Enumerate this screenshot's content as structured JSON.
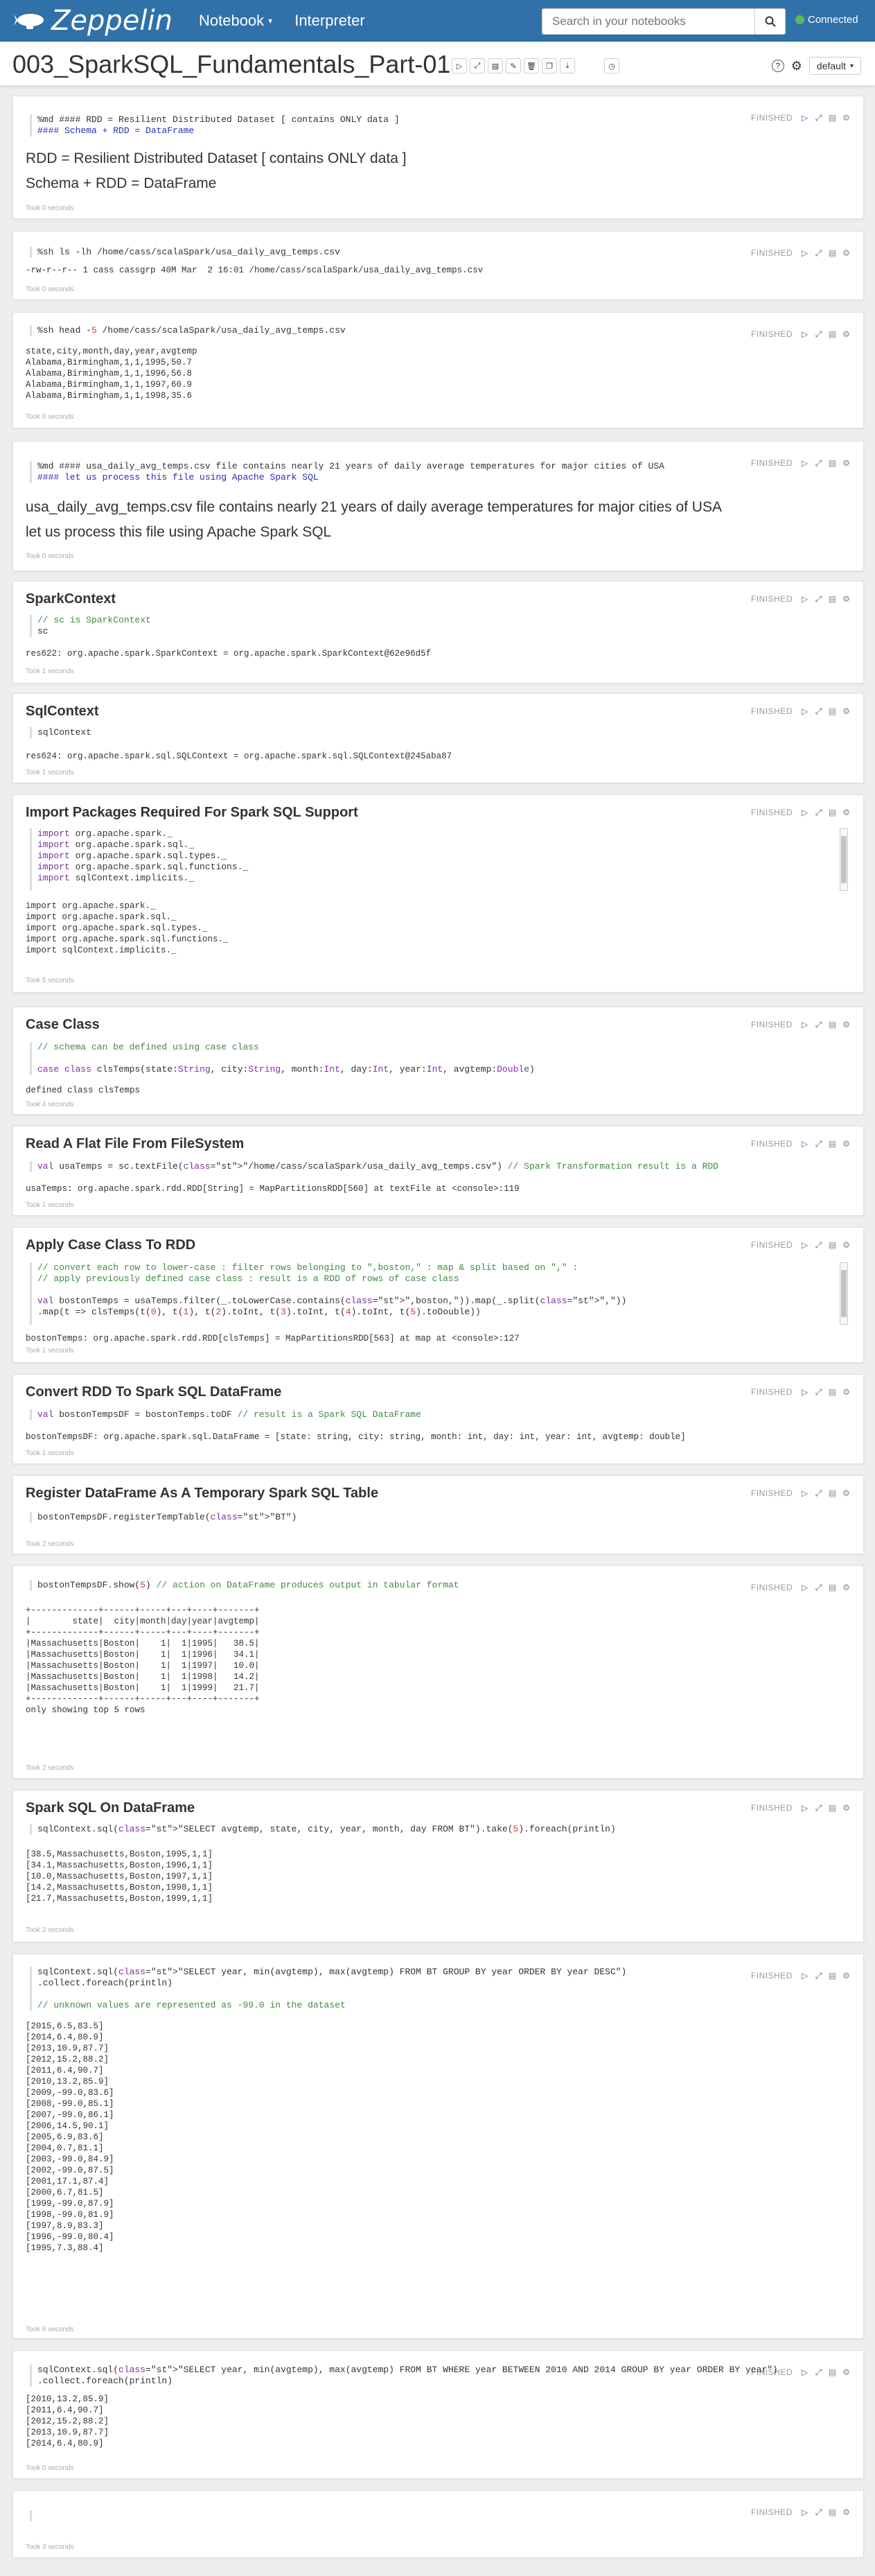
{
  "nav": {
    "brand": "Zeppelin",
    "notebook_menu": "Notebook",
    "interpreter": "Interpreter",
    "search_placeholder": "Search in your notebooks",
    "connection_status": "Connected"
  },
  "notebook": {
    "title": "003_SparkSQL_Fundamentals_Part-01",
    "default_button": "default"
  },
  "paragraphs": [
    {
      "status": "FINISHED",
      "took": "Took 0 seconds",
      "code": [
        "%md #### RDD = Resilient Distributed Dataset [ contains ONLY data ]",
        "#### Schema + RDD = DataFrame"
      ],
      "rendered": [
        "RDD = Resilient Distributed Dataset [ contains ONLY data ]",
        "Schema + RDD = DataFrame"
      ]
    },
    {
      "status": "FINISHED",
      "took": "Took 0 seconds",
      "code": [
        "%sh ls -lh /home/cass/scalaSpark/usa_daily_avg_temps.csv"
      ],
      "output": [
        "-rw-r--r-- 1 cass cassgrp 40M Mar  2 16:01 /home/cass/scalaSpark/usa_daily_avg_temps.csv"
      ]
    },
    {
      "status": "FINISHED",
      "took": "Took 0 seconds",
      "code": [
        "%sh head -5 /home/cass/scalaSpark/usa_daily_avg_temps.csv"
      ],
      "output": [
        "state,city,month,day,year,avgtemp",
        "Alabama,Birmingham,1,1,1995,50.7",
        "Alabama,Birmingham,1,1,1996,56.8",
        "Alabama,Birmingham,1,1,1997,60.9",
        "Alabama,Birmingham,1,1,1998,35.6"
      ]
    },
    {
      "status": "FINISHED",
      "took": "Took 0 seconds",
      "code": [
        "%md #### usa_daily_avg_temps.csv file contains nearly 21 years of daily average temperatures for major cities of USA",
        "#### let us process this file using Apache Spark SQL"
      ],
      "rendered": [
        "usa_daily_avg_temps.csv file contains nearly 21 years of daily average temperatures for major cities of USA",
        "let us process this file using Apache Spark SQL"
      ]
    },
    {
      "title": "SparkContext",
      "status": "FINISHED",
      "took": "Took 1 seconds",
      "code": [
        "// sc is SparkContext",
        "sc"
      ],
      "output": [
        "res622: org.apache.spark.SparkContext = org.apache.spark.SparkContext@62e96d5f"
      ]
    },
    {
      "title": "SqlContext",
      "status": "FINISHED",
      "took": "Took 1 seconds",
      "code": [
        "sqlContext"
      ],
      "output": [
        "res624: org.apache.spark.sql.SQLContext = org.apache.spark.sql.SQLContext@245aba87"
      ]
    },
    {
      "title": "Import Packages Required For Spark SQL Support",
      "status": "FINISHED",
      "took": "Took 5 seconds",
      "code": [
        "import org.apache.spark._",
        "import org.apache.spark.sql._",
        "import org.apache.spark.sql.types._",
        "import org.apache.spark.sql.functions._",
        "import sqlContext.implicits._"
      ],
      "output": [
        "import org.apache.spark._",
        "import org.apache.spark.sql._",
        "import org.apache.spark.sql.types._",
        "import org.apache.spark.sql.functions._",
        "import sqlContext.implicits._"
      ]
    },
    {
      "title": "Case Class",
      "status": "FINISHED",
      "took": "Took 4 seconds",
      "code": [
        "// schema can be defined using case class",
        "",
        "case class clsTemps(state:String, city:String, month:Int, day:Int, year:Int, avgtemp:Double)"
      ],
      "output": [
        "defined class clsTemps"
      ]
    },
    {
      "title": "Read A Flat File From FileSystem",
      "status": "FINISHED",
      "took": "Took 1 seconds",
      "code": [
        "val usaTemps = sc.textFile(\"/home/cass/scalaSpark/usa_daily_avg_temps.csv\") // Spark Transformation result is a RDD"
      ],
      "output": [
        "usaTemps: org.apache.spark.rdd.RDD[String] = MapPartitionsRDD[560] at textFile at <console>:119"
      ]
    },
    {
      "title": "Apply Case Class To RDD",
      "status": "FINISHED",
      "took": "Took 1 seconds",
      "code": [
        "// convert each row to lower-case : filter rows belonging to \",boston,\" : map & split based on \",\" :",
        "// apply previously defined case class : result is a RDD of rows of case class",
        "",
        "val bostonTemps = usaTemps.filter(_.toLowerCase.contains(\",boston,\")).map(_.split(\",\"))",
        ".map(t => clsTemps(t(0), t(1), t(2).toInt, t(3).toInt, t(4).toInt, t(5).toDouble))"
      ],
      "output": [
        "bostonTemps: org.apache.spark.rdd.RDD[clsTemps] = MapPartitionsRDD[563] at map at <console>:127"
      ]
    },
    {
      "title": "Convert RDD To Spark SQL DataFrame",
      "status": "FINISHED",
      "took": "Took 1 seconds",
      "code": [
        "val bostonTempsDF = bostonTemps.toDF // result is a Spark SQL DataFrame"
      ],
      "output": [
        "bostonTempsDF: org.apache.spark.sql.DataFrame = [state: string, city: string, month: int, day: int, year: int, avgtemp: double]"
      ]
    },
    {
      "title": "Register DataFrame As A Temporary Spark SQL Table",
      "status": "FINISHED",
      "took": "Took 2 seconds",
      "code": [
        "bostonTempsDF.registerTempTable(\"BT\")"
      ]
    },
    {
      "status": "FINISHED",
      "took": "Took 2 seconds",
      "code": [
        "bostonTempsDF.show(5) // action on DataFrame produces output in tabular format"
      ],
      "output": [
        "+-------------+------+-----+---+----+-------+",
        "|        state|  city|month|day|year|avgtemp|",
        "+-------------+------+-----+---+----+-------+",
        "|Massachusetts|Boston|    1|  1|1995|   38.5|",
        "|Massachusetts|Boston|    1|  1|1996|   34.1|",
        "|Massachusetts|Boston|    1|  1|1997|   10.0|",
        "|Massachusetts|Boston|    1|  1|1998|   14.2|",
        "|Massachusetts|Boston|    1|  1|1999|   21.7|",
        "+-------------+------+-----+---+----+-------+",
        "only showing top 5 rows"
      ]
    },
    {
      "title": "Spark SQL On DataFrame",
      "status": "FINISHED",
      "took": "Took 2 seconds",
      "code": [
        "sqlContext.sql(\"SELECT avgtemp, state, city, year, month, day FROM BT\").take(5).foreach(println)"
      ],
      "output": [
        "[38.5,Massachusetts,Boston,1995,1,1]",
        "[34.1,Massachusetts,Boston,1996,1,1]",
        "[10.0,Massachusetts,Boston,1997,1,1]",
        "[14.2,Massachusetts,Boston,1998,1,1]",
        "[21.7,Massachusetts,Boston,1999,1,1]"
      ]
    },
    {
      "status": "FINISHED",
      "took": "Took 6 seconds",
      "code": [
        "sqlContext.sql(\"SELECT year, min(avgtemp), max(avgtemp) FROM BT GROUP BY year ORDER BY year DESC\")",
        ".collect.foreach(println)",
        "",
        "// unknown values are represented as -99.0 in the dataset"
      ],
      "output": [
        "[2015,6.5,83.5]",
        "[2014,6.4,80.9]",
        "[2013,10.9,87.7]",
        "[2012,15.2,88.2]",
        "[2011,6.4,90.7]",
        "[2010,13.2,85.9]",
        "[2009,-99.0,83.6]",
        "[2008,-99.0,85.1]",
        "[2007,-99.0,86.1]",
        "[2006,14.5,90.1]",
        "[2005,6.9,83.6]",
        "[2004,0.7,81.1]",
        "[2003,-99.0,84.9]",
        "[2002,-99.0,87.5]",
        "[2001,17.1,87.4]",
        "[2000,6.7,81.5]",
        "[1999,-99.0,87.9]",
        "[1998,-99.0,81.9]",
        "[1997,8.9,83.3]",
        "[1996,-99.0,80.4]",
        "[1995,7.3,88.4]"
      ]
    },
    {
      "status": "FINISHED",
      "took": "Took 0 seconds",
      "code": [
        "sqlContext.sql(\"SELECT year, min(avgtemp), max(avgtemp) FROM BT WHERE year BETWEEN 2010 AND 2014 GROUP BY year ORDER BY year\")",
        ".collect.foreach(println)"
      ],
      "output": [
        "[2010,13.2,85.9]",
        "[2011,6.4,90.7]",
        "[2012,15.2,88.2]",
        "[2013,10.9,87.7]",
        "[2014,6.4,80.9]"
      ]
    },
    {
      "status": "FINISHED",
      "took": "Took 3 seconds",
      "code": [
        ""
      ]
    }
  ]
}
